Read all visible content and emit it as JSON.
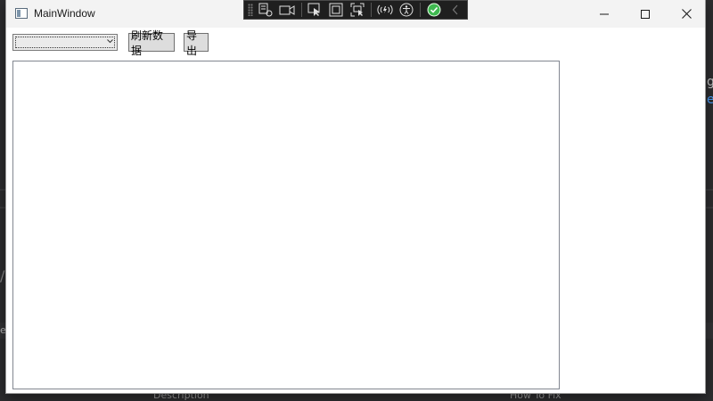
{
  "background": {
    "right_fragments": [
      "g",
      "e"
    ],
    "left_fragment": "es",
    "slash": "/",
    "columns": [
      "Description",
      "How To Fix"
    ]
  },
  "window": {
    "title": "MainWindow",
    "caption": {
      "minimize_icon": "minimize-icon",
      "maximize_icon": "maximize-icon",
      "close_icon": "close-icon"
    }
  },
  "debug_toolbar": {
    "icons": [
      "live-visual-tree-icon",
      "record-icon",
      "select-element-icon",
      "display-adorners-icon",
      "track-focus-icon",
      "hot-reload-icon",
      "accessibility-icon",
      "check-status-icon",
      "collapse-icon"
    ],
    "accent": "#3fb950"
  },
  "toolbar": {
    "combo_value": "",
    "refresh_label": "刷新数据",
    "export_label": "导出"
  },
  "list": {
    "items": []
  }
}
